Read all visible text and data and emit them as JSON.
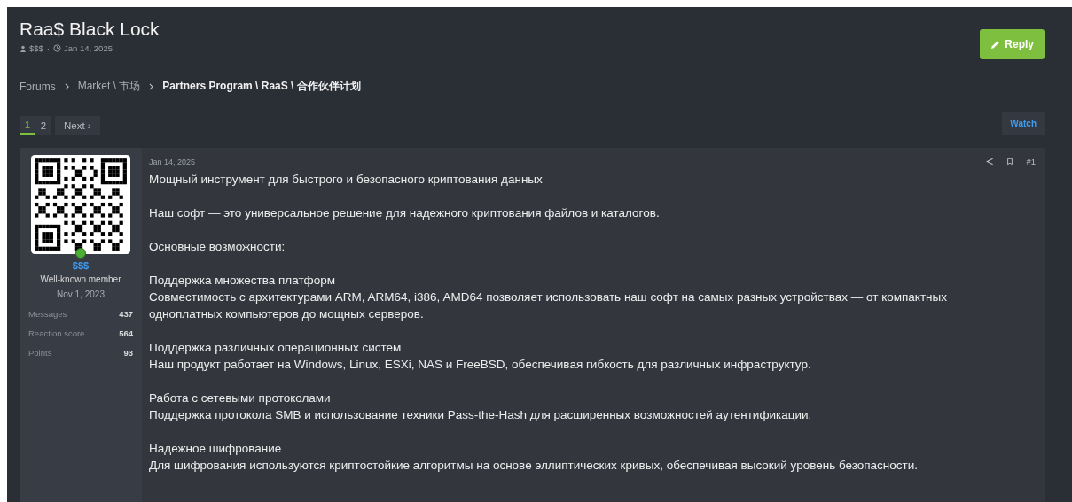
{
  "thread": {
    "title": "Raa$ Black Lock",
    "author": "$$$",
    "date": "Jan 14, 2025",
    "separator": "·"
  },
  "reply_button": "Reply",
  "breadcrumbs": [
    {
      "label": "Forums",
      "current": false
    },
    {
      "label": "Market \\ 市场",
      "current": false
    },
    {
      "label": "Partners Program \\ RaaS \\ 合作伙伴计划",
      "current": true
    }
  ],
  "pagination": {
    "pages": [
      {
        "label": "1",
        "selected": true
      },
      {
        "label": "2",
        "selected": false
      }
    ],
    "next": "Next ›"
  },
  "watch_button": "Watch",
  "post": {
    "user": {
      "name": "$$$",
      "title": "Well-known member",
      "joined": "Nov 1, 2023",
      "online": true,
      "stats": [
        {
          "label": "Messages",
          "value": "437"
        },
        {
          "label": "Reaction score",
          "value": "564"
        },
        {
          "label": "Points",
          "value": "93"
        }
      ]
    },
    "date": "Jan 14, 2025",
    "number": "#1",
    "paragraphs": [
      [
        "Мощный инструмент для быстрого и безопасного криптования данных"
      ],
      [
        "Наш софт — это универсальное решение для надежного криптования файлов и каталогов."
      ],
      [
        "Основные возможности:"
      ],
      [
        "Поддержка множества платформ",
        "Совместимость с архитектурами ARM, ARM64, i386, AMD64 позволяет использовать наш софт на самых разных устройствах — от компактных одноплатных компьютеров до мощных серверов."
      ],
      [
        "Поддержка различных операционных систем",
        "Наш продукт работает на Windows, Linux, ESXi, NAS и FreeBSD, обеспечивая гибкость для различных инфраструктур."
      ],
      [
        "Работа с сетевыми протоколами",
        "Поддержка протокола SMB и использование техники Pass-the-Hash для расширенных возможностей аутентификации."
      ],
      [
        "Надежное шифрование",
        "Для шифрования используются криптостойкие алгоритмы на основе эллиптических кривых, обеспечивая высокий уровень безопасности."
      ]
    ]
  }
}
